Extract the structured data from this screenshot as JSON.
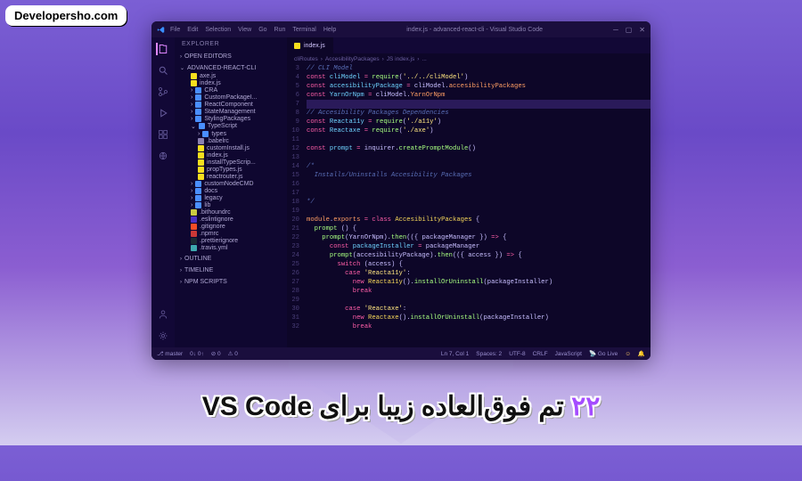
{
  "site": "Developersho.com",
  "headline_prefix": "۲۲",
  "headline_rest": " تم فوق‌العاده زیبا برای VS Code",
  "titlebar": {
    "menu": [
      "File",
      "Edit",
      "Selection",
      "View",
      "Go",
      "Run",
      "Terminal",
      "Help"
    ],
    "title": "index.js - advanced-react-cli - Visual Studio Code"
  },
  "sidebar": {
    "panel": "EXPLORER",
    "sections": {
      "open_editors": "OPEN EDITORS",
      "project": "ADVANCED-REACT-CLI",
      "outline": "OUTLINE",
      "timeline": "TIMELINE",
      "npm": "NPM SCRIPTS"
    },
    "tree": [
      {
        "depth": 1,
        "icon": "js",
        "label": "axe.js"
      },
      {
        "depth": 1,
        "icon": "js",
        "label": "index.js"
      },
      {
        "depth": 1,
        "icon": "folder",
        "label": "CRA"
      },
      {
        "depth": 1,
        "icon": "folder",
        "label": "CustomPackageI..."
      },
      {
        "depth": 1,
        "icon": "folder",
        "label": "ReactComponent"
      },
      {
        "depth": 1,
        "icon": "folder",
        "label": "StateManagement"
      },
      {
        "depth": 1,
        "icon": "folder",
        "label": "StylingPackages"
      },
      {
        "depth": 1,
        "icon": "folder-open",
        "label": "TypeScript",
        "open": true
      },
      {
        "depth": 2,
        "icon": "folder",
        "label": "types"
      },
      {
        "depth": 2,
        "icon": "txt",
        "label": ".babelrc"
      },
      {
        "depth": 2,
        "icon": "js",
        "label": "customInstall.js"
      },
      {
        "depth": 2,
        "icon": "js",
        "label": "index.js"
      },
      {
        "depth": 2,
        "icon": "js",
        "label": "installTypeScrip..."
      },
      {
        "depth": 2,
        "icon": "js",
        "label": "propTypes.js"
      },
      {
        "depth": 2,
        "icon": "js",
        "label": "reactrouter.js"
      },
      {
        "depth": 1,
        "icon": "folder",
        "label": "customNodeCMD"
      },
      {
        "depth": 1,
        "icon": "folder",
        "label": "docs"
      },
      {
        "depth": 1,
        "icon": "folder",
        "label": "legacy"
      },
      {
        "depth": 1,
        "icon": "folder",
        "label": "lib"
      },
      {
        "depth": 1,
        "icon": "json",
        "label": ".bithoundrc"
      },
      {
        "depth": 1,
        "icon": "eslint",
        "label": ".eslintignore"
      },
      {
        "depth": 1,
        "icon": "git",
        "label": ".gitignore"
      },
      {
        "depth": 1,
        "icon": "npm",
        "label": ".npmrc"
      },
      {
        "depth": 1,
        "icon": "prettier",
        "label": ".prettierignore"
      },
      {
        "depth": 1,
        "icon": "travis",
        "label": ".travis.yml"
      }
    ]
  },
  "tabs": [
    {
      "label": "index.js",
      "icon": "js",
      "active": true
    }
  ],
  "breadcrumbs": [
    "cliRoutes",
    "AccesibilityPackages",
    "JS index.js",
    "..."
  ],
  "code": {
    "start": 3,
    "lines": [
      {
        "t": "comment",
        "s": "// CLI Model"
      },
      {
        "t": "raw",
        "html": "<span class='c-keyword'>const</span> <span class='c-const'>cliModel</span> <span class='c-op'>=</span> <span class='c-func'>require</span>(<span class='c-string'>'../../cliModel'</span>)"
      },
      {
        "t": "raw",
        "html": "<span class='c-keyword'>const</span> <span class='c-const'>accesibilityPackage</span> <span class='c-op'>=</span> <span class='c-var'>cliModel</span>.<span class='c-prop'>accesibilityPackages</span>"
      },
      {
        "t": "raw",
        "html": "<span class='c-keyword'>const</span> <span class='c-const'>YarnOrNpm</span> <span class='c-op'>=</span> <span class='c-var'>cliModel</span>.<span class='c-prop'>YarnOrNpm</span>"
      },
      {
        "t": "hl",
        "html": ""
      },
      {
        "t": "comment",
        "s": "// Accesibility Packages Dependencies"
      },
      {
        "t": "raw",
        "html": "<span class='c-keyword'>const</span> <span class='c-const'>Reacta11y</span> <span class='c-op'>=</span> <span class='c-func'>require</span>(<span class='c-string'>'./a11y'</span>)"
      },
      {
        "t": "raw",
        "html": "<span class='c-keyword'>const</span> <span class='c-const'>Reactaxe</span> <span class='c-op'>=</span> <span class='c-func'>require</span>(<span class='c-string'>'./axe'</span>)"
      },
      {
        "t": "blank",
        "s": ""
      },
      {
        "t": "raw",
        "html": "<span class='c-keyword'>const</span> <span class='c-const'>prompt</span> <span class='c-op'>=</span> <span class='c-var'>inquirer</span>.<span class='c-func'>createPromptModule</span>()"
      },
      {
        "t": "blank",
        "s": ""
      },
      {
        "t": "comment",
        "s": "/*"
      },
      {
        "t": "comment",
        "s": "  Installs/Uninstalls Accesibility Packages"
      },
      {
        "t": "blank",
        "s": ""
      },
      {
        "t": "blank",
        "s": ""
      },
      {
        "t": "comment",
        "s": "*/"
      },
      {
        "t": "blank",
        "s": ""
      },
      {
        "t": "raw",
        "html": "<span class='c-prop'>module</span>.<span class='c-prop'>exports</span> <span class='c-op'>=</span> <span class='c-keyword'>class</span> <span class='c-class'>AccesibilityPackages</span> {"
      },
      {
        "t": "raw",
        "html": "  <span class='c-func'>prompt</span> () {"
      },
      {
        "t": "raw",
        "html": "    <span class='c-func'>prompt</span>(<span class='c-var'>YarnOrNpm</span>).<span class='c-func'>then</span>(({ <span class='c-var'>packageManager</span> }) <span class='c-op'>=></span> {"
      },
      {
        "t": "raw",
        "html": "      <span class='c-keyword'>const</span> <span class='c-const'>packageInstaller</span> <span class='c-op'>=</span> <span class='c-var'>packageManager</span>"
      },
      {
        "t": "raw",
        "html": "      <span class='c-func'>prompt</span>(<span class='c-var'>accesibilityPackage</span>).<span class='c-func'>then</span>(({ <span class='c-var'>access</span> }) <span class='c-op'>=></span> {"
      },
      {
        "t": "raw",
        "html": "        <span class='c-keyword'>switch</span> (<span class='c-var'>access</span>) {"
      },
      {
        "t": "raw",
        "html": "          <span class='c-keyword'>case</span> <span class='c-string'>'Reacta11y'</span>:"
      },
      {
        "t": "raw",
        "html": "            <span class='c-keyword'>new</span> <span class='c-class'>Reacta11y</span>().<span class='c-func'>installOrUninstall</span>(<span class='c-var'>packageInstaller</span>)"
      },
      {
        "t": "raw",
        "html": "            <span class='c-keyword'>break</span>"
      },
      {
        "t": "blank",
        "s": ""
      },
      {
        "t": "raw",
        "html": "          <span class='c-keyword'>case</span> <span class='c-string'>'Reactaxe'</span>:"
      },
      {
        "t": "raw",
        "html": "            <span class='c-keyword'>new</span> <span class='c-class'>Reactaxe</span>().<span class='c-func'>installOrUninstall</span>(<span class='c-var'>packageInstaller</span>)"
      },
      {
        "t": "raw",
        "html": "            <span class='c-keyword'>break</span>"
      }
    ]
  },
  "statusbar": {
    "branch": "master",
    "sync": "0↓ 0↑",
    "errors": "0",
    "warnings": "0",
    "ln": "Ln 7, Col 1",
    "spaces": "Spaces: 2",
    "encoding": "UTF-8",
    "eol": "CRLF",
    "lang": "JavaScript",
    "golive": "Go Live"
  }
}
